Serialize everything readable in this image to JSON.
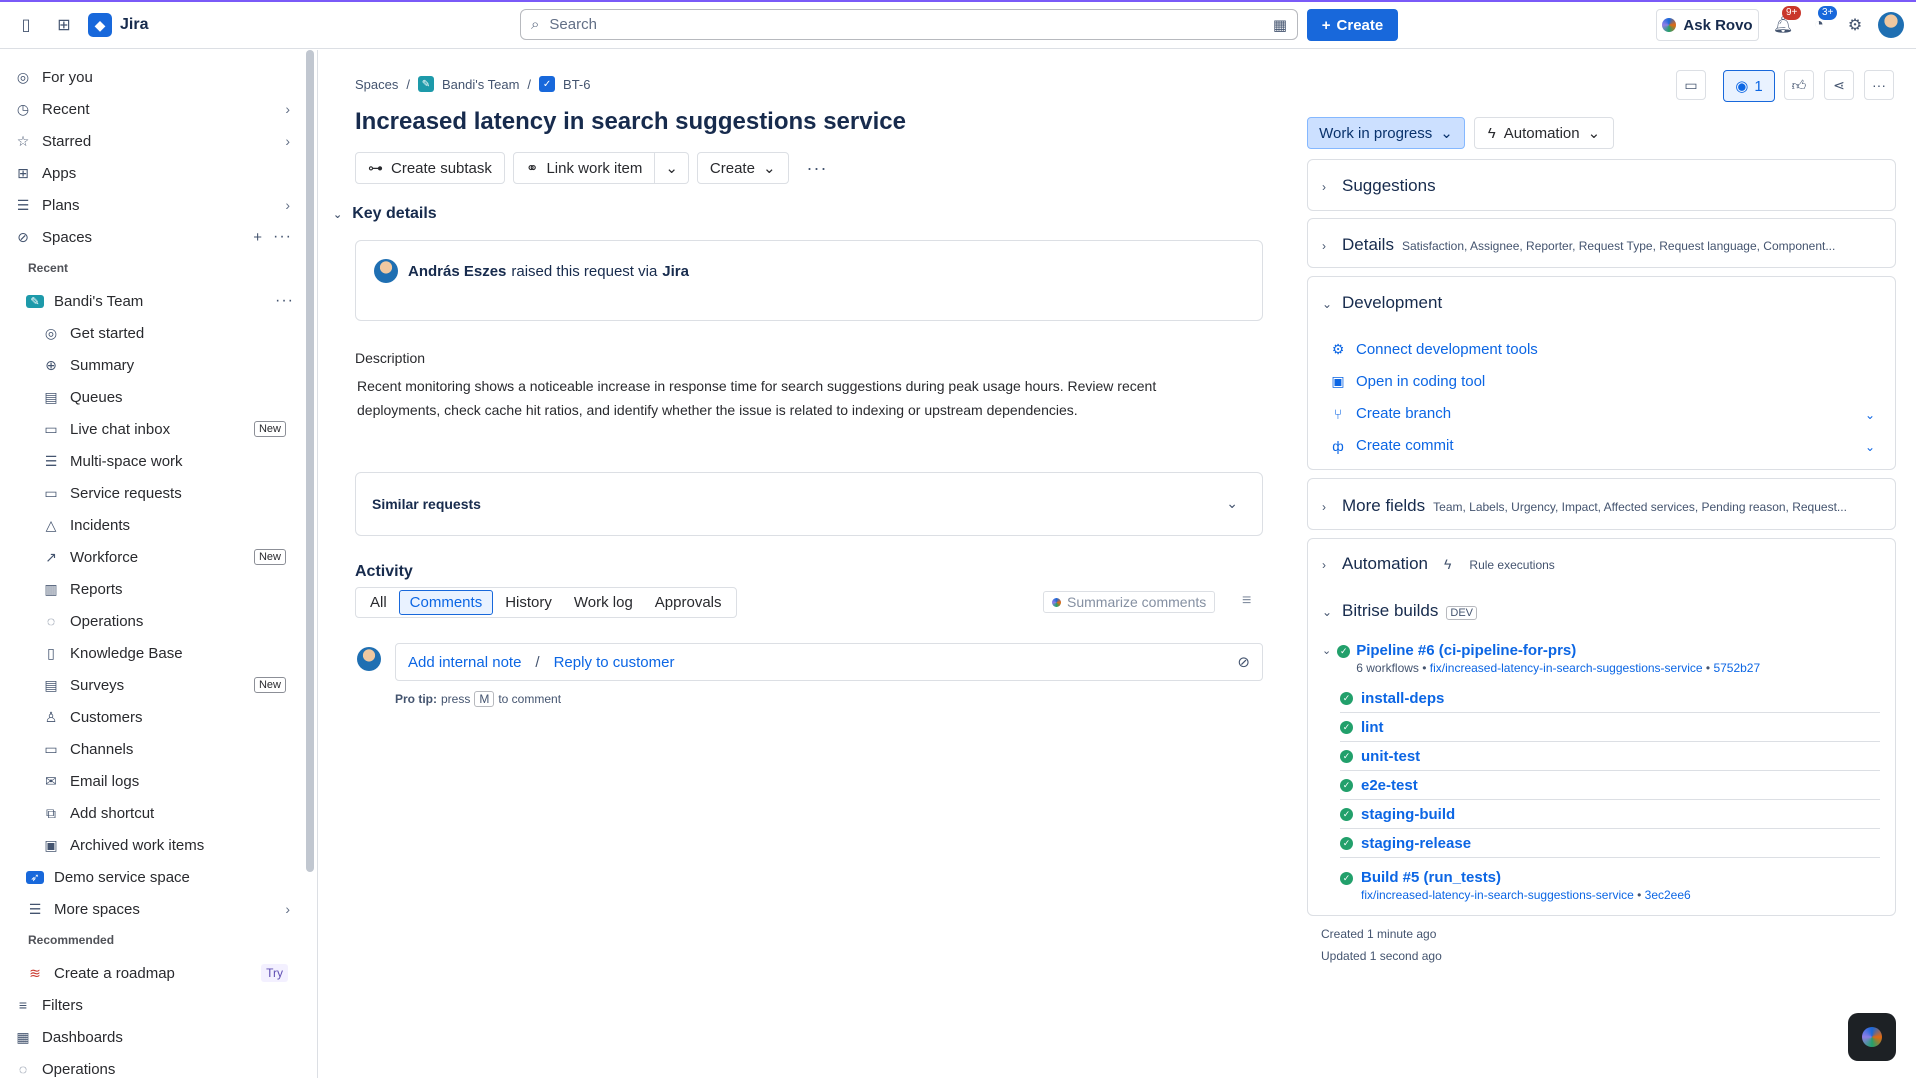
{
  "app": {
    "name": "Jira"
  },
  "search": {
    "placeholder": "Search"
  },
  "top": {
    "create_label": "Create",
    "ask_rovo_label": "Ask Rovo",
    "notifications_badge": "9+",
    "help_badge": "3+"
  },
  "sidebar": {
    "items": [
      {
        "label": "For you",
        "icon": "person-icon"
      },
      {
        "label": "Recent",
        "icon": "clock-icon"
      },
      {
        "label": "Starred",
        "icon": "star-icon"
      },
      {
        "label": "Apps",
        "icon": "grid-icon"
      },
      {
        "label": "Plans",
        "icon": "plans-icon"
      },
      {
        "label": "Spaces",
        "icon": "spaces-icon"
      }
    ],
    "recent_section": "Recent",
    "team_name": "Bandi's Team",
    "team_items": [
      {
        "label": "Get started",
        "icon": "compass-icon"
      },
      {
        "label": "Summary",
        "icon": "globe-icon"
      },
      {
        "label": "Queues",
        "icon": "queue-icon"
      },
      {
        "label": "Live chat inbox",
        "icon": "chat-icon",
        "badge": "New"
      },
      {
        "label": "Multi-space work",
        "icon": "list-icon"
      },
      {
        "label": "Service requests",
        "icon": "message-icon"
      },
      {
        "label": "Incidents",
        "icon": "warning-icon"
      },
      {
        "label": "Workforce",
        "icon": "chart-line-icon",
        "badge": "New"
      },
      {
        "label": "Reports",
        "icon": "bar-chart-icon"
      },
      {
        "label": "Operations",
        "icon": "operations-icon"
      },
      {
        "label": "Knowledge Base",
        "icon": "book-icon"
      },
      {
        "label": "Surveys",
        "icon": "survey-icon",
        "badge": "New"
      },
      {
        "label": "Customers",
        "icon": "customer-icon"
      },
      {
        "label": "Channels",
        "icon": "monitor-icon"
      },
      {
        "label": "Email logs",
        "icon": "mail-icon"
      },
      {
        "label": "Add shortcut",
        "icon": "add-shortcut-icon"
      },
      {
        "label": "Archived work items",
        "icon": "archive-icon"
      }
    ],
    "demo_space": "Demo service space",
    "more_spaces": "More spaces",
    "recommended_section": "Recommended",
    "roadmap": "Create a roadmap",
    "roadmap_badge": "Try",
    "filters": "Filters",
    "dashboards": "Dashboards",
    "operations": "Operations"
  },
  "breadcrumb": {
    "root": "Spaces",
    "team": "Bandi's Team",
    "key": "BT-6"
  },
  "issue": {
    "title": "Increased latency in search suggestions service",
    "actions": {
      "subtask": "Create subtask",
      "link": "Link work item",
      "create": "Create"
    },
    "key_details": "Key details",
    "reporter_name": "András Eszes",
    "raised_text": "raised this request via",
    "raised_via": "Jira",
    "description_label": "Description",
    "description": "Recent monitoring shows a noticeable increase in response time for search suggestions during peak usage hours. Review recent deployments, check cache hit ratios, and identify whether the issue is related to indexing or upstream dependencies.",
    "similar_requests": "Similar requests"
  },
  "activity": {
    "label": "Activity",
    "tabs": [
      "All",
      "Comments",
      "History",
      "Work log",
      "Approvals"
    ],
    "active_tab": "Comments",
    "summarize": "Summarize comments",
    "add_internal_note": "Add internal note",
    "separator": "/",
    "reply_to_customer": "Reply to customer",
    "protip_label": "Pro tip:",
    "protip_press": "press",
    "protip_key": "M",
    "protip_rest": "to comment"
  },
  "right": {
    "watchers": "1",
    "status": "Work in progress",
    "automation": "Automation",
    "suggestions": "Suggestions",
    "details": "Details",
    "details_sub": "Satisfaction, Assignee, Reporter, Request Type, Request language, Component...",
    "development": "Development",
    "dev_items": [
      "Connect development tools",
      "Open in coding tool",
      "Create branch",
      "Create commit"
    ],
    "more_fields": "More fields",
    "more_fields_sub": "Team, Labels, Urgency, Impact, Affected services, Pending reason, Request...",
    "automation_panel": "Automation",
    "rule_executions": "Rule executions",
    "bitrise": "Bitrise builds",
    "bitrise_tag": "DEV",
    "pipeline": {
      "name": "Pipeline #6 (ci-pipeline-for-prs)",
      "workflows": "6 workflows",
      "branch": "fix/increased-latency-in-search-suggestions-service",
      "commit": "5752b27",
      "steps": [
        "install-deps",
        "lint",
        "unit-test",
        "e2e-test",
        "staging-build",
        "staging-release"
      ]
    },
    "build5": {
      "name": "Build #5 (run_tests)",
      "branch": "fix/increased-latency-in-search-suggestions-service",
      "commit": "3ec2ee6"
    },
    "created": "Created 1 minute ago",
    "updated": "Updated 1 second ago"
  }
}
